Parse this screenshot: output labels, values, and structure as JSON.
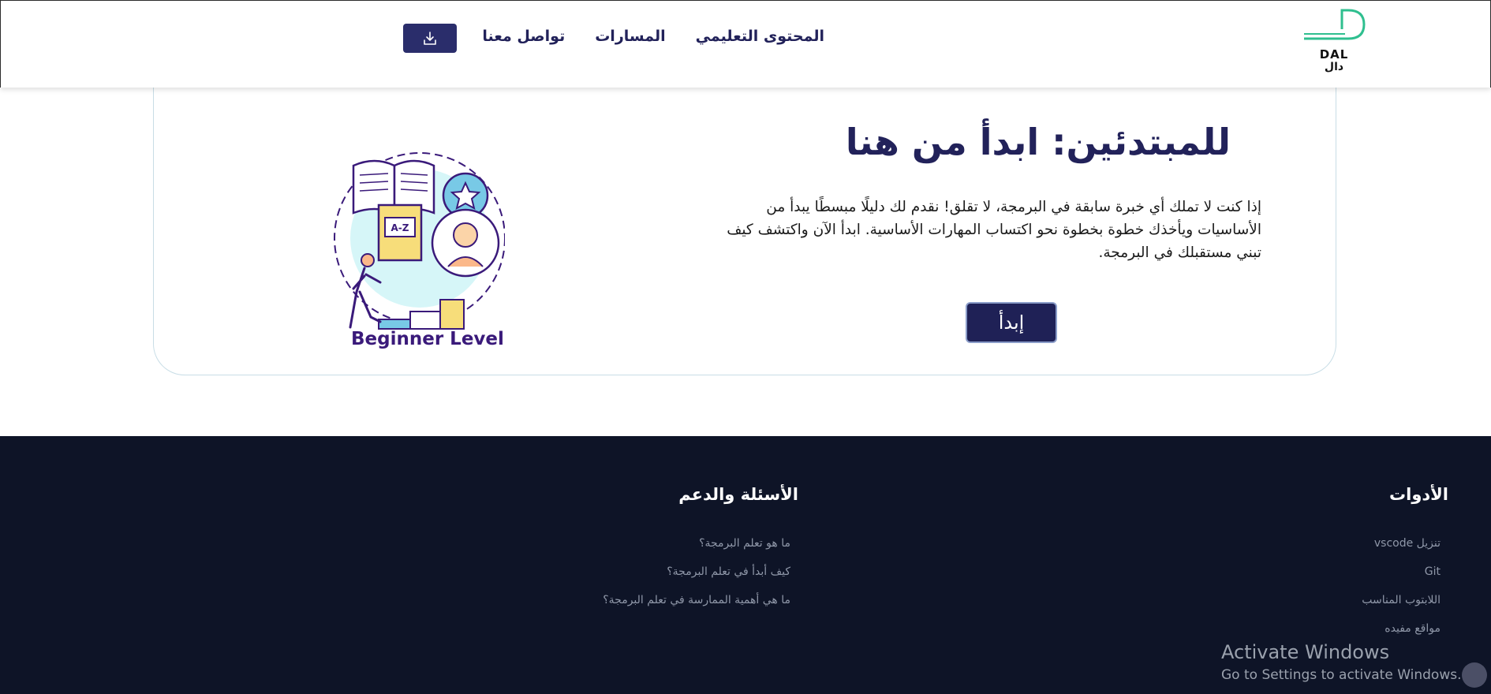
{
  "header": {
    "logo": {
      "text_en": "DAL",
      "text_ar": "دال"
    },
    "nav": [
      {
        "label": "المحتوى التعليمي"
      },
      {
        "label": "المسارات"
      },
      {
        "label": "تواصل معنا"
      }
    ],
    "download_icon": "download-icon"
  },
  "hero": {
    "title": "للمبتدئين: ابدأ من هنا",
    "description": "إذا كنت لا تملك أي خبرة سابقة في البرمجة، لا تقلق! نقدم لك دليلًا مبسطًا يبدأ من الأساسيات ويأخذك خطوة بخطوة نحو اكتساب المهارات الأساسية. ابدأ الآن واكتشف كيف تبني مستقبلك في البرمجة.",
    "button_label": "إبدأ",
    "illustration_label": "Beginner Level",
    "illustration_letters": "A-Z"
  },
  "footer": {
    "tools": {
      "title": "الأدوات",
      "links": [
        "تنزيل vscode",
        "Git",
        "اللابتوب المناسب",
        "مواقع مفيده"
      ]
    },
    "faq": {
      "title": "الأسئلة والدعم",
      "links": [
        "ما هو تعلم البرمجة؟",
        "كيف أبدأ في تعلم البرمجة؟",
        "ما هي أهمية الممارسة في تعلم البرمجة؟"
      ]
    }
  },
  "os_overlay": {
    "title": "Activate Windows",
    "subtitle": "Go to Settings to activate Windows."
  },
  "colors": {
    "primary": "#22225a",
    "button": "#2a2d6b",
    "footer_bg": "#0e1427",
    "logo_green": "#2fbf8f"
  }
}
